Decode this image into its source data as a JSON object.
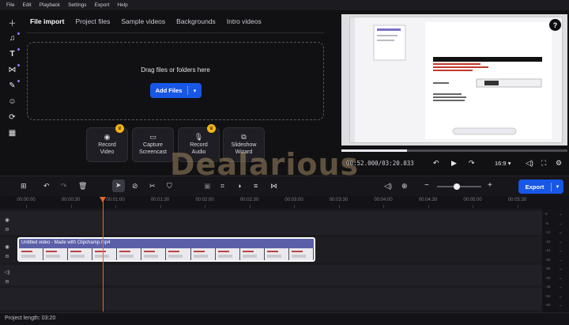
{
  "menu": [
    "File",
    "Edit",
    "Playback",
    "Settings",
    "Export",
    "Help"
  ],
  "tabs": [
    {
      "label": "File import",
      "active": true
    },
    {
      "label": "Project files",
      "active": false
    },
    {
      "label": "Sample videos",
      "active": false
    },
    {
      "label": "Backgrounds",
      "active": false
    },
    {
      "label": "Intro videos",
      "active": false
    }
  ],
  "dropzone": {
    "text": "Drag files or folders here",
    "add_files_label": "Add Files"
  },
  "record_buttons": [
    {
      "line1": "Record",
      "line2": "Video",
      "premium": true,
      "icon": "webcam-icon"
    },
    {
      "line1": "Capture",
      "line2": "Screencast",
      "premium": false,
      "icon": "monitor-icon"
    },
    {
      "line1": "Record",
      "line2": "Audio",
      "premium": true,
      "icon": "microphone-icon"
    },
    {
      "line1": "Slideshow",
      "line2": "Wizard",
      "premium": false,
      "icon": "slideshow-icon"
    }
  ],
  "left_tools": [
    "plus-icon",
    "music-icon",
    "text-icon",
    "transition-icon",
    "effects-icon",
    "sticker-icon",
    "overlay-icon",
    "more-icon"
  ],
  "playback": {
    "time": "00:52.000/03:20.033",
    "aspect": "16:9",
    "progress": 0.29
  },
  "watermark": "Dealarious",
  "export_label": "Export",
  "ruler_ticks": [
    "00:00:00",
    "00:00:30",
    "00:01:00",
    "00:01:30",
    "00:02:00",
    "00:02:30",
    "00:03:00",
    "00:03:30",
    "00:04:00",
    "00:04:30",
    "00:05:00",
    "00:05:30"
  ],
  "clip": {
    "title": "Untitled video - Made with Clipchamp.mp4",
    "thumb_count": 12
  },
  "meter_labels": [
    "0",
    "-6",
    "-12",
    "-18",
    "-24",
    "-30",
    "-36",
    "-42",
    "-48",
    "-54",
    "-60"
  ],
  "status": {
    "project_length": "Project length: 03:20"
  },
  "colors": {
    "accent": "#1857e6",
    "playhead": "#e46a2a",
    "crown": "#f2b417"
  }
}
